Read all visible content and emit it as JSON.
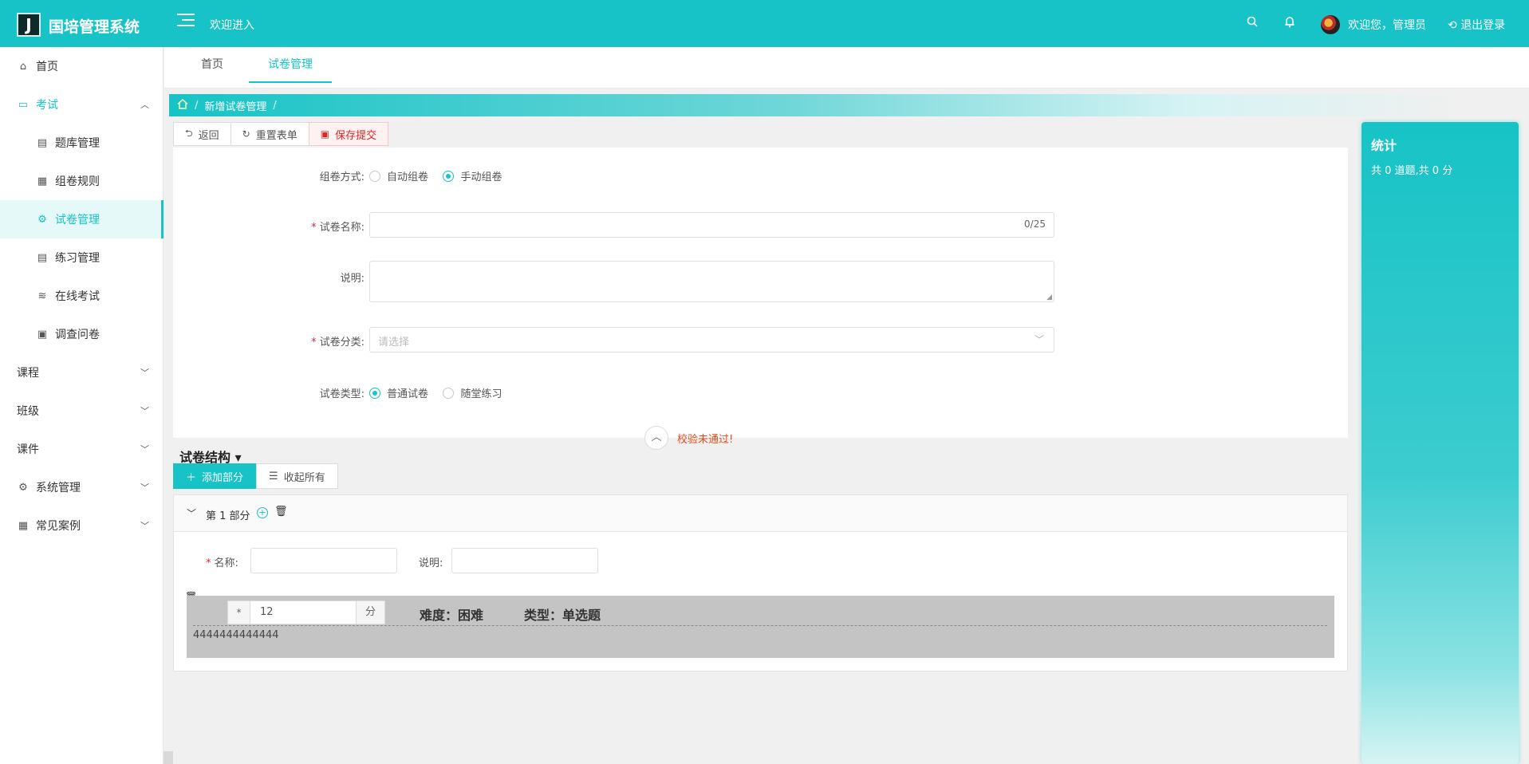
{
  "header": {
    "logo_letter": "J",
    "brand": "国培管理系统",
    "welcome": "欢迎进入",
    "user_greeting": "欢迎您，管理员",
    "logout": "退出登录"
  },
  "sidebar": {
    "items": [
      {
        "label": "首页",
        "icon": "home-icon"
      },
      {
        "label": "考试",
        "icon": "book-icon"
      },
      {
        "label": "题库管理",
        "icon": "file-icon"
      },
      {
        "label": "组卷规则",
        "icon": "building-icon"
      },
      {
        "label": "试卷管理",
        "icon": "gear-icon"
      },
      {
        "label": "练习管理",
        "icon": "file-icon"
      },
      {
        "label": "在线考试",
        "icon": "wifi-icon"
      },
      {
        "label": "调查问卷",
        "icon": "doc-icon"
      },
      {
        "label": "课程",
        "icon": ""
      },
      {
        "label": "班级",
        "icon": ""
      },
      {
        "label": "课件",
        "icon": ""
      },
      {
        "label": "系统管理",
        "icon": "gear-icon"
      },
      {
        "label": "常见案例",
        "icon": "grid-icon"
      }
    ]
  },
  "tabs": [
    {
      "label": "首页"
    },
    {
      "label": "试卷管理"
    }
  ],
  "breadcrumb": {
    "current": "新增试卷管理"
  },
  "toolbar": {
    "back": "返回",
    "reset": "重置表单",
    "save": "保存提交"
  },
  "form": {
    "mode_label": "组卷方式:",
    "mode_options": [
      "自动组卷",
      "手动组卷"
    ],
    "mode_selected": "手动组卷",
    "name_label": "试卷名称:",
    "name_value": "",
    "name_counter": "0/25",
    "desc_label": "说明:",
    "desc_value": "",
    "category_label": "试卷分类:",
    "category_placeholder": "请选择",
    "type_label": "试卷类型:",
    "type_options": [
      "普通试卷",
      "随堂练习"
    ],
    "type_selected": "普通试卷"
  },
  "validation": {
    "message": "校验未通过!"
  },
  "structure": {
    "title": "试卷结构",
    "add_part": "添加部分",
    "collapse_all": "收起所有",
    "parts": [
      {
        "title": "第 1 部分",
        "name_label": "名称:",
        "name_value": "",
        "desc_label": "说明:",
        "desc_value": "",
        "questions": [
          {
            "score_prefix": "*",
            "score": "12",
            "score_suffix": "分",
            "difficulty": "难度：困难",
            "type": "类型：单选题",
            "text": "4444444444444"
          }
        ]
      }
    ]
  },
  "stats": {
    "title": "统计",
    "summary": "共 0 道题,共 0 分"
  },
  "colors": {
    "accent": "#17c3c6",
    "danger": "#e02424"
  }
}
